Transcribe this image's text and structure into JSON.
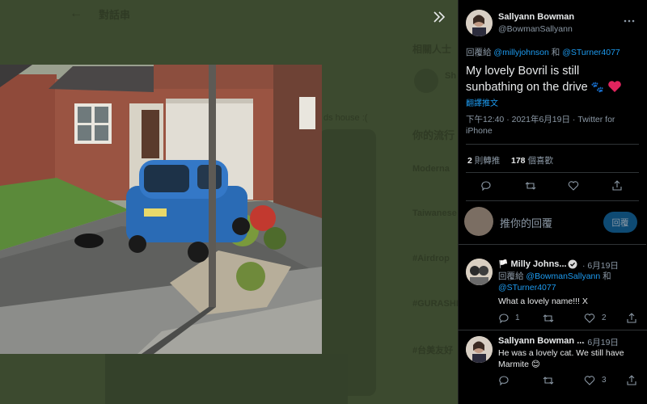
{
  "background": {
    "header_title": "對話串",
    "related_title": "相關人士",
    "trending_title": "你的流行",
    "side_items": [
      "Moderna",
      "Taiwanese",
      "#Airdrop",
      "#GURASHI",
      "#台美友好"
    ],
    "snippet": "ds house :(",
    "sh_text": "Sh"
  },
  "main_tweet": {
    "name": "Sallyann Bowman",
    "handle": "@BowmanSallyann",
    "reply_prefix": "回覆給",
    "reply_mention1": "@millyjohnson",
    "reply_and": "和",
    "reply_mention2": "@STurner4077",
    "text_line1": "My lovely Bovril is still",
    "text_line2": "sunbathing on the drive",
    "emoji": "🐾",
    "translate": "翻譯推文",
    "time_line1": "下午12:40 · 2021年6月19日 · Twitter for",
    "time_line2": "iPhone",
    "retweets_count": "2",
    "retweets_label": "則轉推",
    "likes_count": "178",
    "likes_label": "個喜歡"
  },
  "reply_box": {
    "placeholder": "推你的回覆",
    "button": "回覆"
  },
  "replies": [
    {
      "name": "Milly Johns...",
      "time": "· 6月19日",
      "reply_prefix": "回覆給",
      "mention1": "@BowmanSallyann",
      "and": "和",
      "mention2": "@STurner4077",
      "text": "What a lovely name!!! X",
      "reply_count": "1",
      "retweet_count": "",
      "like_count": "2"
    },
    {
      "name": "Sallyann Bowman ...",
      "time": "· 6月19日",
      "text_line1": "He was a lovely cat. We still have",
      "text_line2": "Marmite",
      "emoji": "😊",
      "reply_count": "",
      "retweet_count": "",
      "like_count": "3"
    }
  ],
  "colors": {
    "accent": "#1d9bf0",
    "overlay": "#3c4a2f",
    "like_heart": "#e0245e"
  },
  "icons": [
    "expand-icon",
    "reply-icon",
    "retweet-icon",
    "like-icon",
    "share-icon",
    "verified-icon",
    "more-icon"
  ]
}
